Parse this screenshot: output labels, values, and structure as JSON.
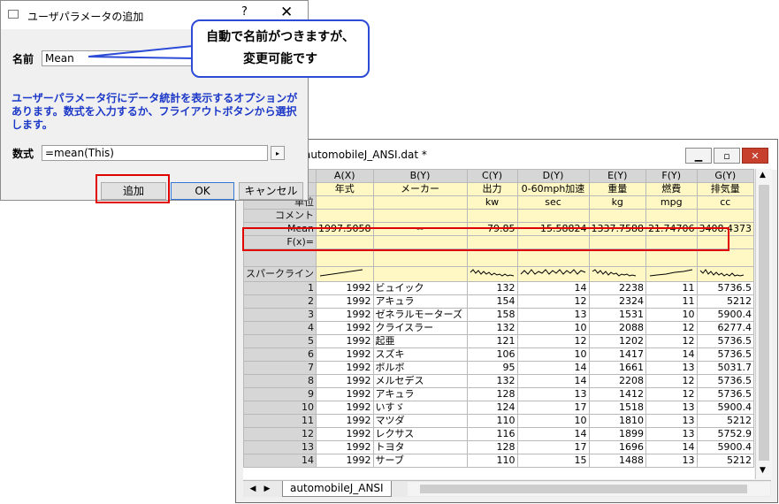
{
  "dialog": {
    "title": "ユーザパラメータの追加",
    "help": "?",
    "close": "✕",
    "name_label": "名前",
    "name_value": "Mean",
    "description": "ユーザーパラメータ行にデータ統計を表示するオプションがあります。数式を入力するか、フライアウトボタンから選択します。",
    "formula_label": "数式",
    "formula_value": "=mean(This)",
    "flyout": "▸",
    "buttons": {
      "add": "追加",
      "ok": "OK",
      "cancel": "キャンセル"
    }
  },
  "callout": {
    "line1": "自動で名前がつきますが、",
    "line2": "変更可能です"
  },
  "workbook": {
    "title": "automobileJ_ANSI.dat *",
    "sheet_tab": "automobileJ_ANSI",
    "row_labels": {
      "long_name": "",
      "units": "単位",
      "comments": "コメント",
      "mean": "Mean",
      "fx": "F(x)=",
      "sparklines": "スパークライン"
    },
    "columns": [
      {
        "header": "A(X)",
        "long_name": "年式",
        "units": "",
        "mean": "1997.5058"
      },
      {
        "header": "B(Y)",
        "long_name": "メーカー",
        "units": "",
        "mean": "--"
      },
      {
        "header": "C(Y)",
        "long_name": "出力",
        "units": "kw",
        "mean": "79.85"
      },
      {
        "header": "D(Y)",
        "long_name": "0-60mph加速",
        "units": "sec",
        "mean": "15.58824"
      },
      {
        "header": "E(Y)",
        "long_name": "重量",
        "units": "kg",
        "mean": "1337.7588"
      },
      {
        "header": "F(Y)",
        "long_name": "燃費",
        "units": "mpg",
        "mean": "21.74706"
      },
      {
        "header": "G(Y)",
        "long_name": "排気量",
        "units": "cc",
        "mean": "3408.4373"
      }
    ],
    "rows": [
      [
        "1",
        "1992",
        "ビュイック",
        "132",
        "14",
        "2238",
        "11",
        "5736.5"
      ],
      [
        "2",
        "1992",
        "アキュラ",
        "154",
        "12",
        "2324",
        "11",
        "5212"
      ],
      [
        "3",
        "1992",
        "ゼネラルモーターズ",
        "158",
        "13",
        "1531",
        "10",
        "5900.4"
      ],
      [
        "4",
        "1992",
        "クライスラー",
        "132",
        "10",
        "2088",
        "12",
        "6277.4"
      ],
      [
        "5",
        "1992",
        "起亜",
        "121",
        "12",
        "1202",
        "12",
        "5736.5"
      ],
      [
        "6",
        "1992",
        "スズキ",
        "106",
        "10",
        "1417",
        "14",
        "5736.5"
      ],
      [
        "7",
        "1992",
        "ボルボ",
        "95",
        "14",
        "1661",
        "13",
        "5031.7"
      ],
      [
        "8",
        "1992",
        "メルセデス",
        "132",
        "14",
        "2208",
        "12",
        "5736.5"
      ],
      [
        "9",
        "1992",
        "アキュラ",
        "128",
        "13",
        "1412",
        "12",
        "5736.5"
      ],
      [
        "10",
        "1992",
        "いすゞ",
        "124",
        "17",
        "1518",
        "13",
        "5900.4"
      ],
      [
        "11",
        "1992",
        "マツダ",
        "110",
        "10",
        "1810",
        "13",
        "5212"
      ],
      [
        "12",
        "1992",
        "レクサス",
        "116",
        "14",
        "1899",
        "13",
        "5752.9"
      ],
      [
        "13",
        "1992",
        "トヨタ",
        "128",
        "17",
        "1696",
        "14",
        "5900.4"
      ],
      [
        "14",
        "1992",
        "サーブ",
        "110",
        "15",
        "1488",
        "13",
        "5212"
      ]
    ]
  }
}
